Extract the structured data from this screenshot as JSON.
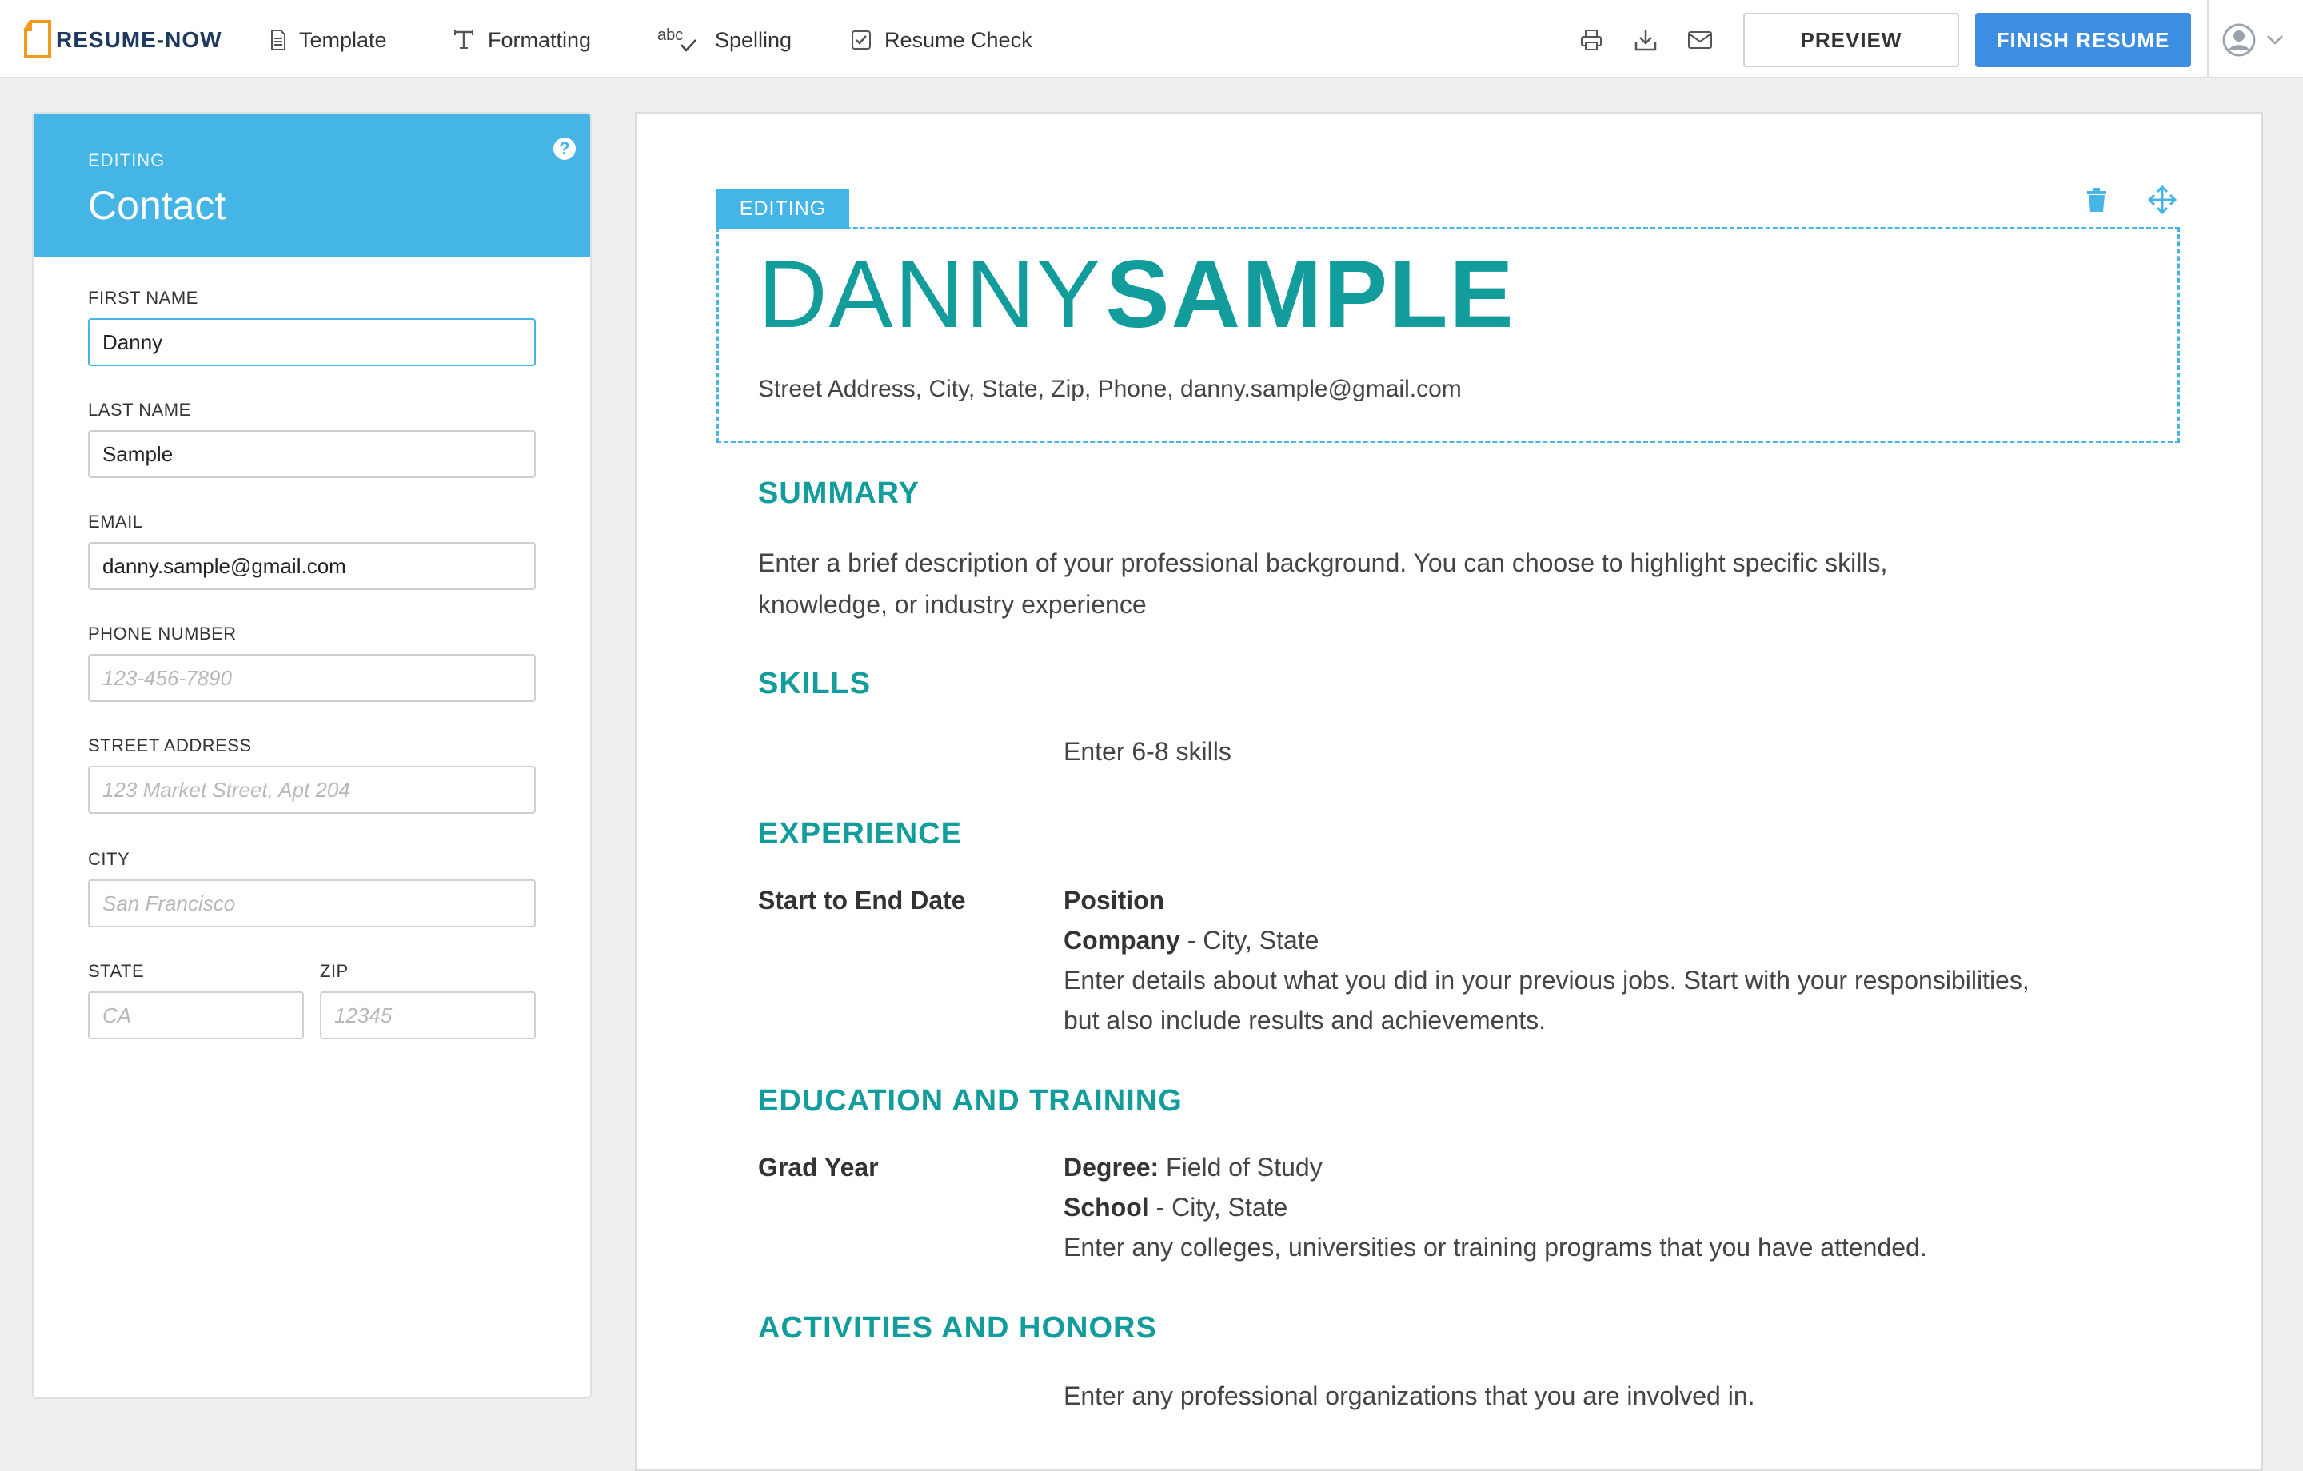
{
  "app": {
    "logo_text": "RESUME-NOW",
    "accent_color": "#45b5e6",
    "brand_teal": "#139c9c",
    "primary_blue": "#3d8de3"
  },
  "toolbar": {
    "nav": [
      {
        "label": "Template",
        "icon": "document-icon"
      },
      {
        "label": "Formatting",
        "icon": "text-format-icon"
      },
      {
        "label": "Spelling",
        "icon": "spellcheck-icon"
      },
      {
        "label": "Resume Check",
        "icon": "checkbox-icon"
      }
    ],
    "print_icon": "printer-icon",
    "download_icon": "download-icon",
    "email_icon": "envelope-icon",
    "preview_label": "PREVIEW",
    "finish_label": "FINISH RESUME",
    "account_icon": "user-avatar-icon"
  },
  "panel": {
    "editing_label": "EDITING",
    "title": "Contact",
    "fields": {
      "first_name": {
        "label": "FIRST NAME",
        "value": "Danny",
        "placeholder": ""
      },
      "last_name": {
        "label": "LAST NAME",
        "value": "Sample",
        "placeholder": ""
      },
      "email": {
        "label": "EMAIL",
        "value": "danny.sample@gmail.com",
        "placeholder": ""
      },
      "phone": {
        "label": "PHONE NUMBER",
        "value": "",
        "placeholder": "123-456-7890"
      },
      "street": {
        "label": "STREET ADDRESS",
        "value": "",
        "placeholder": "123 Market Street, Apt 204"
      },
      "city": {
        "label": "CITY",
        "value": "",
        "placeholder": "San Francisco"
      },
      "state": {
        "label": "STATE",
        "value": "",
        "placeholder": "CA"
      },
      "zip": {
        "label": "ZIP",
        "value": "",
        "placeholder": "12345"
      }
    }
  },
  "resume": {
    "editing_tag": "EDITING",
    "first_name": "DANNY",
    "last_name": "SAMPLE",
    "contact_line": "Street Address, City, State, Zip, Phone, danny.sample@gmail.com",
    "summary": {
      "title": "SUMMARY",
      "line1": "Enter a brief description of your professional background. You can choose to highlight specific skills,",
      "line2": "knowledge, or industry experience"
    },
    "skills": {
      "title": "SKILLS",
      "text": "Enter 6-8 skills"
    },
    "experience": {
      "title": "EXPERIENCE",
      "date": "Start to End Date",
      "position": "Position",
      "company": "Company",
      "company_loc": " - City, State",
      "line1": "Enter details about what you did in your previous jobs. Start with your responsibilities,",
      "line2": "but also include results and achievements."
    },
    "education": {
      "title": "EDUCATION AND TRAINING",
      "year": "Grad Year",
      "degree_label": "Degree:",
      "degree_value": " Field of Study",
      "school": "School",
      "school_loc": " - City, State",
      "text": "Enter any colleges, universities or training programs that you have attended."
    },
    "activities": {
      "title": "ACTIVITIES AND HONORS",
      "text": "Enter any professional organizations that you are involved in."
    }
  }
}
